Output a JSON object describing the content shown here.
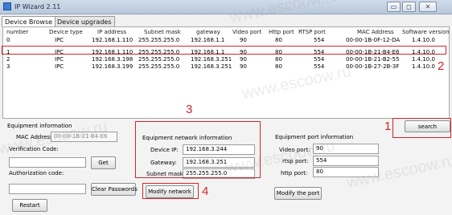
{
  "window": {
    "title": "IP Wizard 2.11"
  },
  "tabs": [
    {
      "label": "Device Browse"
    },
    {
      "label": "Device upgrades"
    }
  ],
  "table": {
    "headers": [
      "number",
      "Device type",
      "IP address",
      "Subnet mask",
      "gateway",
      "Video port",
      "Http port",
      "RTSP port",
      "MAC Address",
      "Software version"
    ],
    "rows": [
      [
        "0",
        "IPC",
        "192.168.1.110",
        "255.255.255.0",
        "192.168.1.1",
        "90",
        "80",
        "554",
        "00-00-1B-0F-12-DA",
        "1.4.10.0"
      ],
      [
        "1",
        "IPC",
        "192.168.1.110",
        "255.255.255.0",
        "192.168.1.1",
        "90",
        "80",
        "554",
        "00-00-1B-21-B4-E6",
        "1.4.10.0"
      ],
      [
        "2",
        "IPC",
        "192.168.3.198",
        "255.255.255.0",
        "192.168.3.251",
        "90",
        "80",
        "554",
        "00-00-1B-21-B2-55",
        "1.4.10.0"
      ],
      [
        "3",
        "IPC",
        "192.168.3.199",
        "255.255.255.0",
        "192.168.3.251",
        "90",
        "80",
        "554",
        "00-00-1B-27-2B-3F",
        "1.4.10.0"
      ]
    ]
  },
  "equipment_info": {
    "heading": "Equipment information",
    "mac_label": "MAC Address:",
    "mac_value": "00-00-1B-21-B4-E6",
    "verification_label": "Verification Code:",
    "verification_value": "",
    "get_button": "Get",
    "authorization_label": "Authorization code:",
    "authorization_value": "",
    "clear_button": "Clear Passwords",
    "restart_button": "Restart"
  },
  "network_info": {
    "heading": "Equipment network information",
    "device_ip_label": "Device IP:",
    "device_ip_value": "192.168.3.244",
    "gateway_label": "Gateway:",
    "gateway_value": "192.168.3.251",
    "subnet_label": "Subnet mask:",
    "subnet_value": "255.255.255.0",
    "modify_network_button": "Modify network"
  },
  "port_info": {
    "heading": "Equipment port information",
    "video_label": "Video port:",
    "video_value": "90",
    "rtsp_label": "rtsp port:",
    "rtsp_value": "554",
    "http_label": "http port:",
    "http_value": "80",
    "modify_port_button": "Modify the port"
  },
  "search_button": "search",
  "annotations": {
    "n1": "1",
    "n2": "2",
    "n3": "3",
    "n4": "4"
  },
  "watermark": "www.escoow.ru",
  "colors": {
    "annotation_red": "#d0262b"
  }
}
